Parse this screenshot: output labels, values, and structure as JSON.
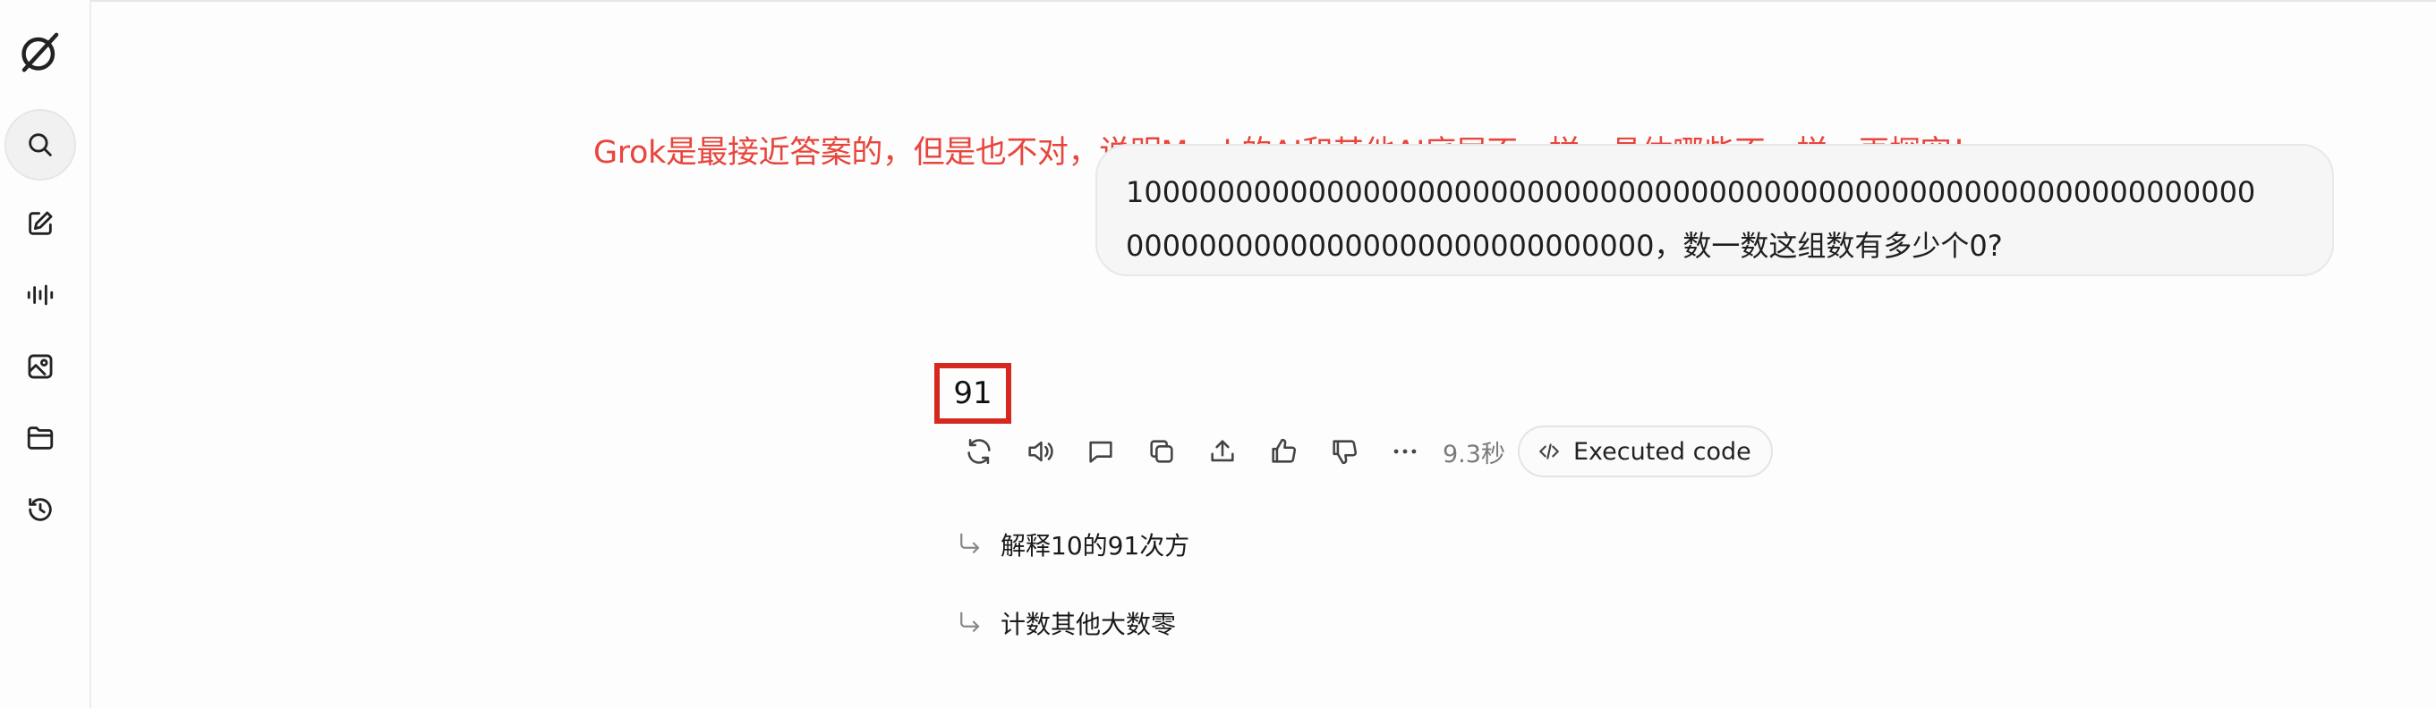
{
  "sidebar": {
    "items": [
      {
        "name": "logo",
        "icon": "grok-logo-icon"
      },
      {
        "name": "search",
        "icon": "search-icon",
        "active": true
      },
      {
        "name": "new-chat",
        "icon": "edit-icon"
      },
      {
        "name": "voice",
        "icon": "voice-waveform-icon"
      },
      {
        "name": "imagine",
        "icon": "image-icon"
      },
      {
        "name": "projects",
        "icon": "folder-icon"
      },
      {
        "name": "history",
        "icon": "history-icon"
      }
    ]
  },
  "annotation": {
    "text": "Grok是最接近答案的，但是也不对，说明Musk的AI和其他AI底层不一样，具体哪些不一样，再探究！",
    "color": "#e8453c"
  },
  "user_message": {
    "line1": "10000000000000000000000000000000000000000000000000000000000000",
    "line2": "00000000000000000000000000000，数一数这组数有多少个0?"
  },
  "answer": {
    "text": "91",
    "highlight_color": "#d5281e"
  },
  "actions": {
    "icons": [
      "regenerate-icon",
      "read-aloud-icon",
      "comment-icon",
      "copy-icon",
      "share-icon",
      "thumbs-up-icon",
      "thumbs-down-icon",
      "more-icon"
    ],
    "time": "9.3秒",
    "executed_code_label": "Executed code"
  },
  "suggestions": [
    {
      "label": "解释10的91次方"
    },
    {
      "label": "计数其他大数零"
    }
  ]
}
